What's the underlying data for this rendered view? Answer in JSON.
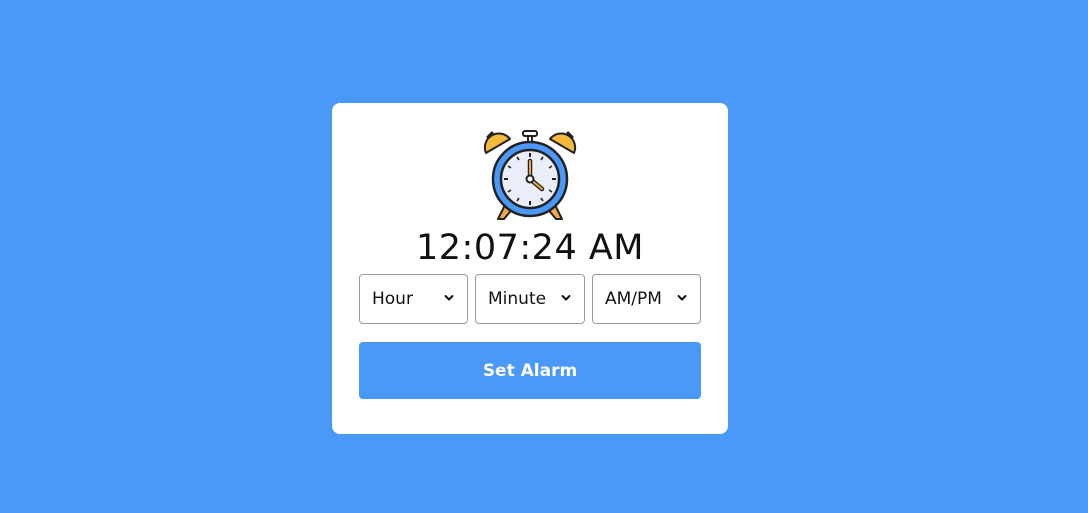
{
  "clock": {
    "icon": "alarm-clock-icon",
    "time": "12:07:24 AM"
  },
  "selects": {
    "hour": {
      "placeholder": "Hour",
      "icon": "chevron-down-icon"
    },
    "minute": {
      "placeholder": "Minute",
      "icon": "chevron-down-icon"
    },
    "ampm": {
      "placeholder": "AM/PM",
      "icon": "chevron-down-icon"
    }
  },
  "actions": {
    "set_alarm_label": "Set Alarm"
  },
  "colors": {
    "background": "#4a98f7",
    "card": "#ffffff",
    "accent": "#4a98f7",
    "bell": "#f6b93b",
    "clock_face_ring": "#4a98f7"
  }
}
